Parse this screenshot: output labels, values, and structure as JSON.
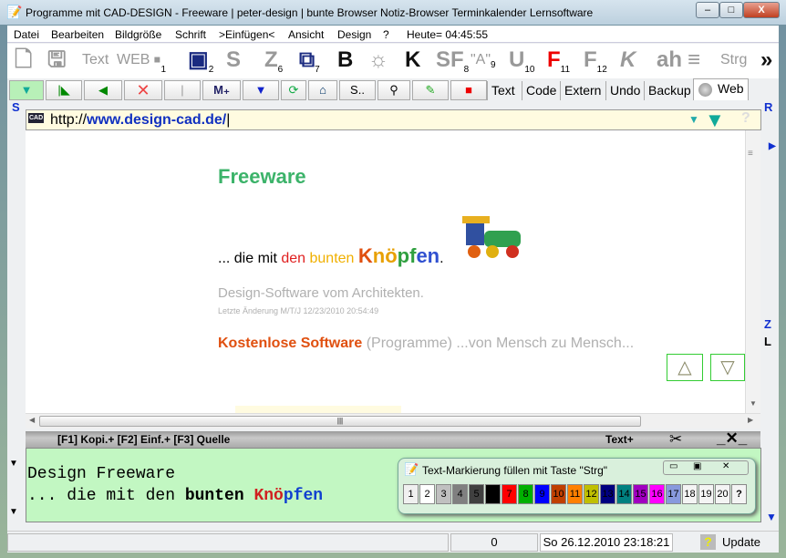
{
  "window": {
    "title": "Programme mit CAD-DESIGN - Freeware | peter-design | bunte Browser Notiz-Browser Terminkalender Lernsoftware",
    "min": "–",
    "max": "□",
    "close": "X"
  },
  "menu": [
    "Datei",
    "Bearbeiten",
    "Bildgröße",
    "Schrift",
    ">Einfügen<",
    "Ansicht",
    "Design",
    "?",
    "Heute= 04:45:55"
  ],
  "toolbar1": [
    {
      "icon": "new-document-icon",
      "g": "🗋"
    },
    {
      "icon": "save-icon",
      "g": "🖫"
    },
    {
      "icon": "text-icon",
      "g": "Text"
    },
    {
      "icon": "web-icon",
      "g": "WEB"
    },
    {
      "icon": "insert-1-icon",
      "g": "▪",
      "n": "1"
    },
    {
      "icon": "insert-2-icon",
      "g": "▣",
      "n": "2"
    },
    {
      "icon": "s-icon",
      "g": "S"
    },
    {
      "icon": "z-icon",
      "g": "Z",
      "n": "6"
    },
    {
      "icon": "window-icon",
      "g": "⧉",
      "n": "7"
    },
    {
      "icon": "bold-select-icon",
      "g": "B"
    },
    {
      "icon": "image-icon",
      "g": "☼"
    },
    {
      "icon": "k-icon",
      "g": "K"
    },
    {
      "icon": "sf-icon",
      "g": "SF",
      "n": "8"
    },
    {
      "icon": "quote-a-icon",
      "g": "\"A\"",
      "n": "9"
    },
    {
      "icon": "underline-icon",
      "g": "U",
      "n": "10"
    },
    {
      "icon": "f-red-icon",
      "g": "F",
      "n": "11"
    },
    {
      "icon": "f-gray-icon",
      "g": "F",
      "n": "12"
    },
    {
      "icon": "italic-k-icon",
      "g": "K"
    },
    {
      "icon": "ah-icon",
      "g": "ah"
    },
    {
      "icon": "align-icon",
      "g": "≡"
    },
    {
      "icon": "strg-icon",
      "g": "Strg"
    },
    {
      "icon": "more-icon",
      "g": "»"
    }
  ],
  "toolbar2": {
    "s_label": "S..",
    "tabs": [
      "Text",
      "Code",
      "Extern",
      "Undo",
      "Backup",
      "Web"
    ]
  },
  "url": {
    "prefix": "http://",
    "host": "www.design-cad.de/"
  },
  "page": {
    "heading": "Freeware",
    "tag_prefix": "... die mit ",
    "tag_den": "den ",
    "tag_bunten": "bunten ",
    "tag_k": "K",
    "tag_noe": "nö",
    "tag_pf": "pf",
    "tag_en": "en",
    "tag_dot": ".",
    "sub": "Design-Software vom Architekten.",
    "changed": "Letzte Änderung M/T/J 12/23/2010 20:54:49",
    "link": "Kostenlose Software",
    "link_rest": "(Programme) ...von Mensch zu Mensch..."
  },
  "fbar": {
    "keys": "[F1] Kopi.+  [F2] Einf.+  [F3] Quelle",
    "textplus": "Text+"
  },
  "notes": {
    "line1": "Design Freeware",
    "line2_a": "... die mit den ",
    "line2_b": "bunten",
    "line2_k": "Knö",
    "line2_p": "pfen"
  },
  "palette": {
    "title": "Text-Markierung füllen mit Taste \"Strg\"",
    "swatches": [
      {
        "n": "1",
        "c": "#f0f0f0"
      },
      {
        "n": "2",
        "c": "#ffffff"
      },
      {
        "n": "3",
        "c": "#c0c0c0"
      },
      {
        "n": "4",
        "c": "#808080"
      },
      {
        "n": "5",
        "c": "#404040"
      },
      {
        "n": "6",
        "c": "#000000"
      },
      {
        "n": "7",
        "c": "#ff0000"
      },
      {
        "n": "8",
        "c": "#00b000"
      },
      {
        "n": "9",
        "c": "#0000ff"
      },
      {
        "n": "10",
        "c": "#c04000"
      },
      {
        "n": "11",
        "c": "#ff8000"
      },
      {
        "n": "12",
        "c": "#c0c000"
      },
      {
        "n": "13",
        "c": "#000080"
      },
      {
        "n": "14",
        "c": "#008080"
      },
      {
        "n": "15",
        "c": "#a000c0"
      },
      {
        "n": "16",
        "c": "#ff00ff"
      },
      {
        "n": "17",
        "c": "#8899dd"
      },
      {
        "n": "18",
        "c": "#f4f4f4"
      },
      {
        "n": "19",
        "c": "#f4f4f4"
      },
      {
        "n": "20",
        "c": "#f4f4f4"
      },
      {
        "n": "?",
        "c": "#f4f4f4"
      }
    ]
  },
  "status": {
    "count": "0",
    "datetime": "So 26.12.2010 23:18:21",
    "update": "Update"
  },
  "side": {
    "s": "S",
    "r": "R",
    "z": "Z",
    "l": "L"
  }
}
